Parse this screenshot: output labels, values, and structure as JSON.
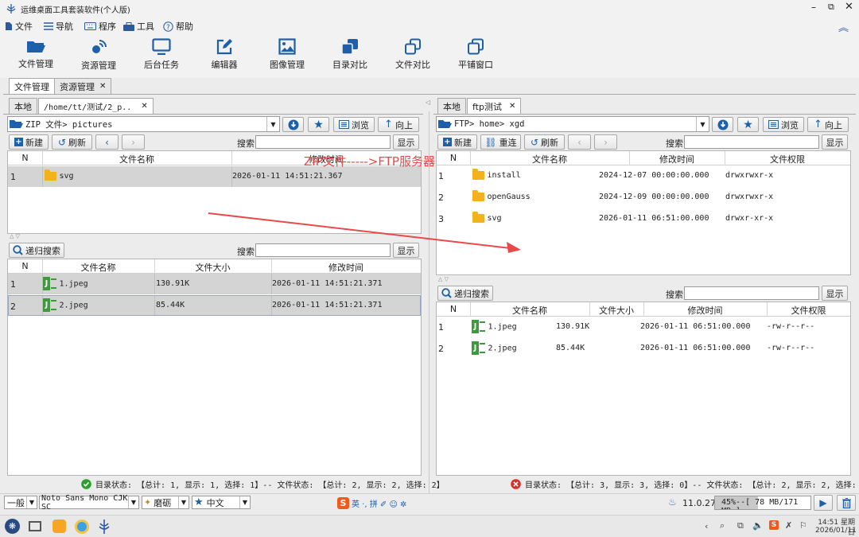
{
  "window": {
    "title": "运维桌面工具套装软件(个人版)"
  },
  "menu": {
    "file": "文件",
    "nav": "导航",
    "program": "程序",
    "tools": "工具",
    "help": "帮助"
  },
  "toolbar": [
    {
      "label": "文件管理",
      "icon": "folder-open-icon"
    },
    {
      "label": "资源管理",
      "icon": "satellite-icon"
    },
    {
      "label": "后台任务",
      "icon": "monitor-icon"
    },
    {
      "label": "编辑器",
      "icon": "edit-icon"
    },
    {
      "label": "图像管理",
      "icon": "image-icon"
    },
    {
      "label": "目录对比",
      "icon": "dir-compare-icon"
    },
    {
      "label": "文件对比",
      "icon": "file-compare-icon"
    },
    {
      "label": "平铺窗口",
      "icon": "tile-window-icon"
    }
  ],
  "main_tabs": [
    {
      "label": "文件管理"
    },
    {
      "label": "资源管理"
    }
  ],
  "common": {
    "new": "新建",
    "refresh": "刷新",
    "reconnect": "重连",
    "search": "搜索",
    "show": "显示",
    "browse": "浏览",
    "up": "向上",
    "recursive_search": "递归搜索"
  },
  "left": {
    "tabs": [
      {
        "label": "本地"
      },
      {
        "label": "/home/tt/测试/2_p.."
      }
    ],
    "path": "ZIP 文件> pictures",
    "dir_headers": [
      "N",
      "文件名称",
      "修改时间"
    ],
    "dir_rows": [
      {
        "n": "1",
        "name": "svg",
        "time": "2026-01-11 14:51:21.367"
      }
    ],
    "file_headers": [
      "N",
      "文件名称",
      "文件大小",
      "修改时间"
    ],
    "file_rows": [
      {
        "n": "1",
        "name": "1.jpeg",
        "size": "130.91K",
        "time": "2026-01-11 14:51:21.371"
      },
      {
        "n": "2",
        "name": "2.jpeg",
        "size": "85.44K",
        "time": "2026-01-11 14:51:21.371"
      }
    ],
    "status": "目录状态: 【总计: 1, 显示: 1, 选择: 1】-- 文件状态: 【总计: 2, 显示: 2, 选择: 2】"
  },
  "right": {
    "tabs": [
      {
        "label": "本地"
      },
      {
        "label": "ftp测试"
      }
    ],
    "path": "FTP> home> xgd",
    "dir_headers": [
      "N",
      "文件名称",
      "修改时间",
      "文件权限"
    ],
    "dir_rows": [
      {
        "n": "1",
        "name": "install",
        "time": "2024-12-07 00:00:00.000",
        "perm": "drwxrwxr-x"
      },
      {
        "n": "2",
        "name": "openGauss",
        "time": "2024-12-09 00:00:00.000",
        "perm": "drwxrwxr-x"
      },
      {
        "n": "3",
        "name": "svg",
        "time": "2026-01-11 06:51:00.000",
        "perm": "drwxr-xr-x"
      }
    ],
    "file_headers": [
      "N",
      "文件名称",
      "文件大小",
      "修改时间",
      "文件权限"
    ],
    "file_rows": [
      {
        "n": "1",
        "name": "1.jpeg",
        "size": "130.91K",
        "time": "2026-01-11 06:51:00.000",
        "perm": "-rw-r--r--"
      },
      {
        "n": "2",
        "name": "2.jpeg",
        "size": "85.44K",
        "time": "2026-01-11 06:51:00.000",
        "perm": "-rw-r--r--"
      }
    ],
    "status": "目录状态: 【总计: 3, 显示: 3, 选择: 0】-- 文件状态: 【总计: 2, 显示: 2, 选择: 0】"
  },
  "annotation": {
    "text": "ZIP文件----->FTP服务器",
    "color": "#e84a4a"
  },
  "bottombar": {
    "mode": "一般",
    "font": "Noto Sans Mono CJK SC",
    "theme": "磨砺",
    "lang": "中文",
    "ime": "英 ·, 拼 ✐ ☺ ✲",
    "version": "11.0.27",
    "memory": "45%--[ 78 MB/171 MB ]"
  },
  "taskbar": {
    "time": "14:51 星期日",
    "date": "2026/01/11"
  },
  "colors": {
    "accent": "#1d5fa8",
    "ok": "#2aa12a",
    "err": "#d9302c"
  }
}
